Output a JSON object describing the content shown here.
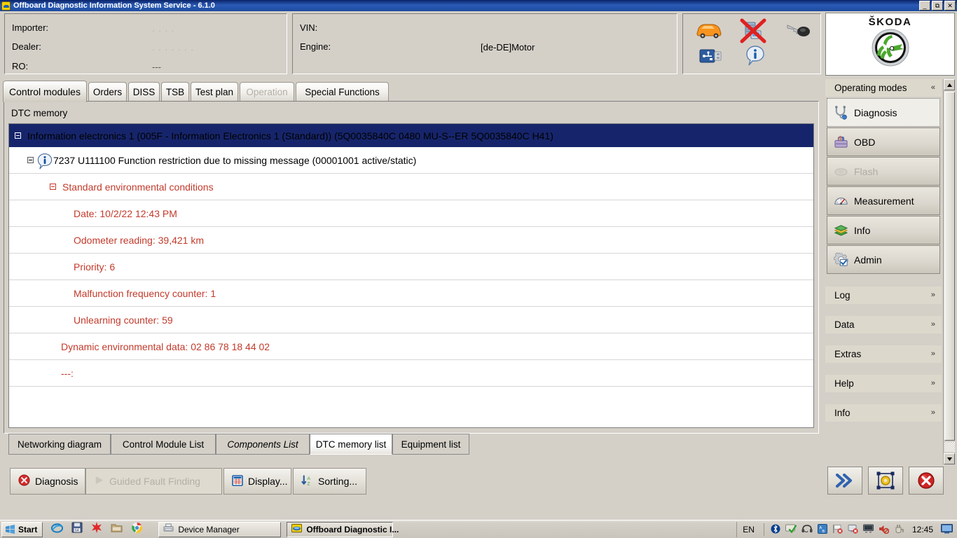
{
  "window": {
    "title": "Offboard Diagnostic Information System Service - 6.1.0",
    "minimize": "_",
    "restore": "❐",
    "close": "✕"
  },
  "header": {
    "left_fields": [
      {
        "label": "Importer:",
        "value": ". . . ."
      },
      {
        "label": "Dealer:",
        "value": ". . . . . . ."
      },
      {
        "label": "RO:",
        "value": "---"
      }
    ],
    "mid_fields": [
      {
        "label": "VIN:",
        "value": ""
      },
      {
        "label": "Engine:",
        "value": "[de-DE]Motor"
      }
    ],
    "icons": [
      "car-icon",
      "server-disconnected-icon",
      "key-icon",
      "usb-icon",
      "info-icon"
    ]
  },
  "brand": {
    "name": "ŠKODA",
    "logo": "skoda-winged-arrow-logo"
  },
  "tabs": [
    {
      "label": "Control modules",
      "state": "active"
    },
    {
      "label": "Orders",
      "state": "normal"
    },
    {
      "label": "DISS",
      "state": "normal"
    },
    {
      "label": "TSB",
      "state": "normal"
    },
    {
      "label": "Test plan",
      "state": "normal"
    },
    {
      "label": "Operation",
      "state": "disabled"
    },
    {
      "label": "Special Functions",
      "state": "normal"
    }
  ],
  "content": {
    "section_title": "DTC memory",
    "tree_rows": [
      {
        "text": "Information electronics 1 (005F - Information Electronics 1 (Standard)) (5Q0035840C    0480   MU-S--ER          5Q0035840C    H41)",
        "style": "selected",
        "indent": 8,
        "expander": true,
        "icon": ""
      },
      {
        "text": "7237   U111100   Function restriction due to missing message  (00001001   active/static)",
        "style": "normal",
        "indent": 26,
        "expander": true,
        "icon": "info-bubble-icon"
      },
      {
        "text": "Standard environmental conditions",
        "style": "fault",
        "indent": 46,
        "expander": true,
        "icon": ""
      },
      {
        "text": "Date: 10/2/22 12:43 PM",
        "style": "fault",
        "indent": 92,
        "expander": false,
        "icon": ""
      },
      {
        "text": "Odometer reading: 39,421 km",
        "style": "fault",
        "indent": 92,
        "expander": false,
        "icon": ""
      },
      {
        "text": "Priority: 6",
        "style": "fault",
        "indent": 92,
        "expander": false,
        "icon": ""
      },
      {
        "text": "Malfunction frequency counter: 1",
        "style": "fault",
        "indent": 92,
        "expander": false,
        "icon": ""
      },
      {
        "text": "Unlearning counter: 59",
        "style": "fault",
        "indent": 92,
        "expander": false,
        "icon": ""
      },
      {
        "text": "Dynamic environmental data: 02 86 78 18 44 02",
        "style": "fault",
        "indent": 74,
        "expander": false,
        "icon": ""
      },
      {
        "text": "---:",
        "style": "fault",
        "indent": 74,
        "expander": false,
        "icon": ""
      }
    ],
    "sub_tabs": [
      {
        "label": "Networking diagram",
        "state": "normal"
      },
      {
        "label": "Control Module List",
        "state": "normal"
      },
      {
        "label": "Components List",
        "state": "italic"
      },
      {
        "label": "DTC memory list",
        "state": "active"
      },
      {
        "label": "Equipment list",
        "state": "normal"
      }
    ]
  },
  "toolbar_buttons": [
    {
      "label": "Diagnosis",
      "icon": "red-x-circle-icon",
      "state": "normal"
    },
    {
      "label": "Guided Fault Finding",
      "icon": "play-triangle-icon",
      "state": "disabled"
    },
    {
      "label": "Display...",
      "icon": "grid-window-icon",
      "state": "normal"
    },
    {
      "label": "Sorting...",
      "icon": "sort-arrows-icon",
      "state": "normal"
    }
  ],
  "sidebar": {
    "sections": [
      {
        "title": "Operating modes",
        "chevron": "«",
        "expanded": true
      },
      {
        "title": "Log",
        "chevron": "»",
        "expanded": false
      },
      {
        "title": "Data",
        "chevron": "»",
        "expanded": false
      },
      {
        "title": "Extras",
        "chevron": "»",
        "expanded": false
      },
      {
        "title": "Help",
        "chevron": "»",
        "expanded": false
      },
      {
        "title": "Info",
        "chevron": "»",
        "expanded": false
      }
    ],
    "modes": [
      {
        "label": "Diagnosis",
        "icon": "stethoscope-icon",
        "state": "active"
      },
      {
        "label": "OBD",
        "icon": "toolbox-icon",
        "state": "normal"
      },
      {
        "label": "Flash",
        "icon": "flash-icon",
        "state": "disabled"
      },
      {
        "label": "Measurement",
        "icon": "gauge-icon",
        "state": "normal"
      },
      {
        "label": "Info",
        "icon": "books-icon",
        "state": "normal"
      },
      {
        "label": "Admin",
        "icon": "gear-check-icon",
        "state": "normal"
      }
    ],
    "action_buttons": [
      {
        "icon": "double-chevron-right-icon",
        "name": "next-button"
      },
      {
        "icon": "frame-target-icon",
        "name": "screenshot-button"
      },
      {
        "icon": "red-x-circle-icon",
        "name": "cancel-button"
      }
    ]
  },
  "taskbar": {
    "start_label": "Start",
    "quick_launch": [
      "ie-icon",
      "save-icon",
      "red-star-icon",
      "folder-icon",
      "chrome-icon"
    ],
    "tasks": [
      {
        "label": "Device Manager",
        "icon": "device-manager-icon",
        "state": "normal"
      },
      {
        "label": "Offboard Diagnostic I...",
        "icon": "odis-icon",
        "state": "active"
      }
    ],
    "language": "EN",
    "tray_icons": [
      "bluetooth-icon",
      "green-check-icon",
      "headset-icon",
      "blue-sync-icon",
      "flag-error-icon",
      "monitor-error-icon",
      "display-icon",
      "volume-muted-icon",
      "plug-icon"
    ],
    "clock": "12:45",
    "show_desktop": "monitor-icon"
  },
  "colors": {
    "titlebar": "#0a246a",
    "selection": "#16256b",
    "fault_text": "#c23a2b",
    "window_bg": "#d4d0c8",
    "brand_green": "#4ba82e"
  }
}
